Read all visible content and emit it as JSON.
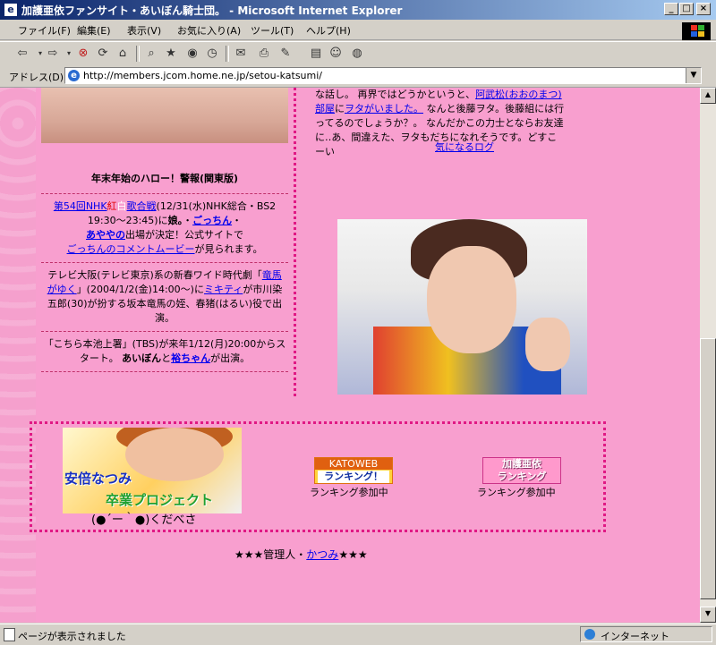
{
  "window": {
    "title": "加護亜依ファンサイト・あいぼん騎士団。 - Microsoft Internet Explorer",
    "minimize": "_",
    "maximize": "□",
    "close": "×"
  },
  "menu": [
    "ファイル(F)",
    "編集(E)",
    "表示(V)",
    "お気に入り(A)",
    "ツール(T)",
    "ヘルプ(H)"
  ],
  "address": {
    "label": "アドレス(D)",
    "url": "http://members.jcom.home.ne.jp/setou-katsumi/"
  },
  "status": {
    "text": "ページが表示されました",
    "zone": "インターネット"
  },
  "right": {
    "t1": "な話し。 再界ではどうかというと、",
    "l1": "阿武松(おおのまつ)部屋",
    "t2": "に",
    "l2": "ヲタがいました。",
    "t3": " なんと後藤ヲタ。後藤組には行ってるのでしょうか？。 なんだかこの力士とならお友達に‥あ、間違えた、ヲタもだちになれそうです。どすこーい",
    "blog": "気になるログ"
  },
  "news": {
    "heading": "年末年始のハロー！警報(関東版)",
    "item1": {
      "link1": "第54回NHK",
      "red": "紅",
      "white": "白",
      "link2": "歌合戦",
      "t1": "(12/31(水)NHK総合・BS2 19:30～23:45)に",
      "bold1": "娘。",
      "dot": "・",
      "link3": "ごっちん",
      "dot2": "・",
      "link4": "あややの",
      "t2": "出場が決定！公式サイトで",
      "link5": "ごっちんのコメントムービー",
      "t3": "が見られます。"
    },
    "item2": {
      "t1": "テレビ大阪(テレビ東京)系の新春ワイド時代劇「",
      "link1": "竜馬がゆく",
      "t2": "」(2004/1/2(金)14:00～)に",
      "link2": "ミキティ",
      "t3": "が市川染五郎(30)が扮する坂本竜馬の姪、春猪(はるい)役で出演。"
    },
    "item3": {
      "t1": "「こちら本池上署」(TBS)が来年1/12(月)20:00からスタート。 ",
      "bold1": "あいぼん",
      "t2": "と",
      "link1": "裕ちゃん",
      "t3": "が出演。"
    }
  },
  "bottom": {
    "banner_line1": "安倍なつみ",
    "banner_line2": "卒業プロジェクト",
    "kaomoji": "(●´ー｀●)くだべさ",
    "rank_a_top": "KATOWEB",
    "rank_a_bot": "ランキング！",
    "rank_b_top": "加護亜依",
    "rank_b_bot": "ランキング",
    "rank_caption": "ランキング参加中"
  },
  "footer": {
    "stars_left": "★★★",
    "t1": "管理人・",
    "link": "かつみ",
    "stars_right": "★★★"
  }
}
